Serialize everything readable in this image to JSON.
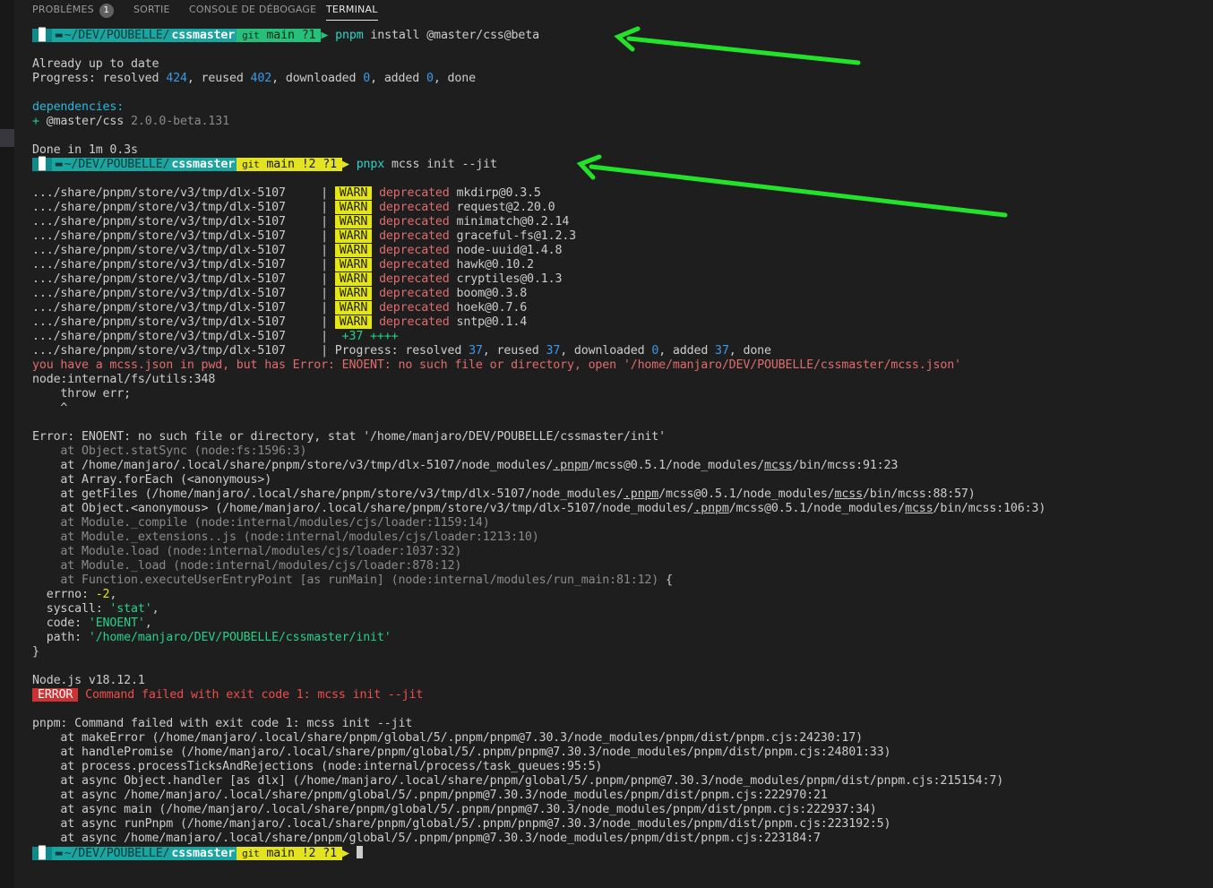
{
  "panel": {
    "tabs": [
      {
        "label": "PROBLÈMES",
        "badge": "1"
      },
      {
        "label": "SORTIE"
      },
      {
        "label": "CONSOLE DE DÉBOGAGE"
      },
      {
        "label": "TERMINAL"
      }
    ]
  },
  "prompt": {
    "host_icon": "▐▌",
    "folder_icon": "▬",
    "dir_prefix": "~/DEV/POUBELLE/",
    "dir_name": "cssmaster",
    "git_icon": "git",
    "branch": "main",
    "status_1": "?1",
    "status_2": "!2 ?1"
  },
  "cmd1": {
    "bin": "pnpm",
    "args": " install @master/css@beta"
  },
  "install": {
    "up_to_date": "Already up to date",
    "progress_label": "Progress: resolved ",
    "resolved": "424",
    "reused_label": ", reused ",
    "reused": "402",
    "downloaded_label": ", downloaded ",
    "downloaded": "0",
    "added_label": ", added ",
    "added": "0",
    "done_label": ", done",
    "deps_header": "dependencies:",
    "dep_plus": "+ ",
    "dep_name": "@master/css ",
    "dep_version": "2.0.0-beta.131",
    "done_time": "Done in 1m 0.3s"
  },
  "cmd2": {
    "bin": "pnpx",
    "args": " mcss init --jit"
  },
  "dlx": {
    "path": ".../share/pnpm/store/v3/tmp/dlx-5107",
    "sep": "|",
    "warn": "WARN",
    "deprecated": "deprecated",
    "warnings": [
      "mkdirp@0.3.5",
      "request@2.20.0",
      "minimatch@0.2.14",
      "graceful-fs@1.2.3",
      "node-uuid@1.4.8",
      "hawk@0.10.2",
      "cryptiles@0.1.3",
      "boom@0.3.8",
      "hoek@0.7.6",
      "sntp@0.1.4"
    ],
    "plus_line": "+37 ++++",
    "progress_label": "Progress: resolved ",
    "resolved": "37",
    "reused_label": ", reused ",
    "reused": "37",
    "downloaded_label": ", downloaded ",
    "downloaded": "0",
    "added_label": ", added ",
    "added": "37",
    "done_label": ", done"
  },
  "err": {
    "mcss_json": "you have a mcss.json in pwd, but has Error: ENOENT: no such file or directory, open '/home/manjaro/DEV/POUBELLE/cssmaster/mcss.json'",
    "internal": "node:internal/fs/utils:348",
    "throw": "    throw err;",
    "caret": "    ^",
    "main": "Error: ENOENT: no such file or directory, stat '/home/manjaro/DEV/POUBELLE/cssmaster/init'",
    "stat_sync": "    at Object.statSync (node:fs:1596:3)",
    "s1": {
      "a": "    at /home/manjaro/.local/share/pnpm/store/v3/tmp/dlx-5107/node_modules/",
      "u1": ".pnpm",
      "b": "/mcss@0.5.1/node_modules/",
      "u2": "mcss",
      "c": "/bin/mcss:91:23"
    },
    "s2": "    at Array.forEach (<anonymous>)",
    "s3": {
      "a": "    at getFiles (/home/manjaro/.local/share/pnpm/store/v3/tmp/dlx-5107/node_modules/",
      "u1": ".pnpm",
      "b": "/mcss@0.5.1/node_modules/",
      "u2": "mcss",
      "c": "/bin/mcss:88:57)"
    },
    "s4": {
      "a": "    at Object.<anonymous> (/home/manjaro/.local/share/pnpm/store/v3/tmp/dlx-5107/node_modules/",
      "u1": ".pnpm",
      "b": "/mcss@0.5.1/node_modules/",
      "u2": "mcss",
      "c": "/bin/mcss:106:3)"
    },
    "g1": "    at Module._compile (node:internal/modules/cjs/loader:1159:14)",
    "g2": "    at Module._extensions..js (node:internal/modules/cjs/loader:1213:10)",
    "g3": "    at Module.load (node:internal/modules/cjs/loader:1037:32)",
    "g4": "    at Module._load (node:internal/modules/cjs/loader:878:12)",
    "g5a": "    at Function.executeUserEntryPoint [as runMain] (node:internal/modules/run_main:81:12)",
    "g5b": " {",
    "errno_k": "  errno: ",
    "errno_v": "-2",
    "syscall_k": "  syscall: ",
    "syscall_v": "'stat'",
    "code_k": "  code: ",
    "code_v": "'ENOENT'",
    "path_k": "  path: ",
    "path_v": "'/home/manjaro/DEV/POUBELLE/cssmaster/init'",
    "close": "}",
    "comma": ",",
    "node_version": "Node.js v18.12.1",
    "error_badge": "ERROR",
    "failed": " Command failed with exit code 1: mcss init --jit",
    "pnpm_failed": "pnpm: Command failed with exit code 1: mcss init --jit",
    "p1": "    at makeError (/home/manjaro/.local/share/pnpm/global/5/.pnpm/pnpm@7.30.3/node_modules/pnpm/dist/pnpm.cjs:24230:17)",
    "p2": "    at handlePromise (/home/manjaro/.local/share/pnpm/global/5/.pnpm/pnpm@7.30.3/node_modules/pnpm/dist/pnpm.cjs:24801:33)",
    "p3": "    at process.processTicksAndRejections (node:internal/process/task_queues:95:5)",
    "p4": "    at async Object.handler [as dlx] (/home/manjaro/.local/share/pnpm/global/5/.pnpm/pnpm@7.30.3/node_modules/pnpm/dist/pnpm.cjs:215154:7)",
    "p5": "    at async /home/manjaro/.local/share/pnpm/global/5/.pnpm/pnpm@7.30.3/node_modules/pnpm/dist/pnpm.cjs:222970:21",
    "p6": "    at async main (/home/manjaro/.local/share/pnpm/global/5/.pnpm/pnpm@7.30.3/node_modules/pnpm/dist/pnpm.cjs:222937:34)",
    "p7": "    at async runPnpm (/home/manjaro/.local/share/pnpm/global/5/.pnpm/pnpm@7.30.3/node_modules/pnpm/dist/pnpm.cjs:223192:5)",
    "p8": "    at async /home/manjaro/.local/share/pnpm/global/5/.pnpm/pnpm@7.30.3/node_modules/pnpm/dist/pnpm.cjs:223184:7"
  },
  "colors": {
    "arrow": "#22e32a",
    "prompt_host": "#0d8b8b",
    "prompt_dir": "#1aa5a0",
    "git_clean": "#26c07a",
    "git_dirty": "#e3e322"
  }
}
